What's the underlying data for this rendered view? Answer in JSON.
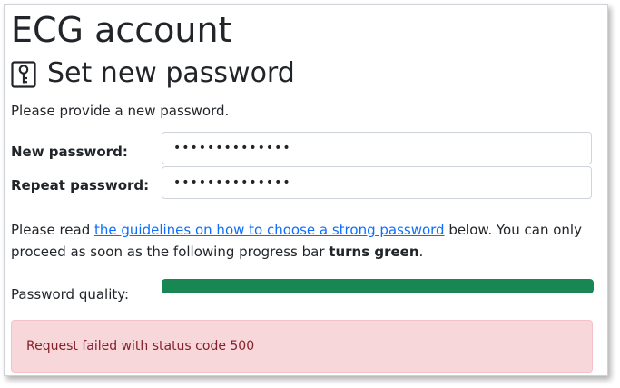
{
  "app": {
    "title": "ECG account"
  },
  "page": {
    "heading": "Set new password",
    "heading_icon": "key-icon",
    "intro": "Please provide a new password."
  },
  "form": {
    "new_password_label": "New password:",
    "new_password_value": "••••••••••••••",
    "repeat_password_label": "Repeat password:",
    "repeat_password_value": "••••••••••••••"
  },
  "guidelines": {
    "text_before": "Please read ",
    "link_text": "the guidelines on how to choose a strong password",
    "text_middle": " below. You can only proceed as soon as the following progress bar ",
    "bold_text": "turns green",
    "text_after": "."
  },
  "quality": {
    "label": "Password quality:",
    "progress": 1.0,
    "color": "#198754"
  },
  "alert": {
    "message": "Request failed with status code 500"
  },
  "colors": {
    "link": "#0d6efd",
    "alert_background": "#f8d7da",
    "alert_text": "#842029",
    "progress_green": "#198754"
  }
}
